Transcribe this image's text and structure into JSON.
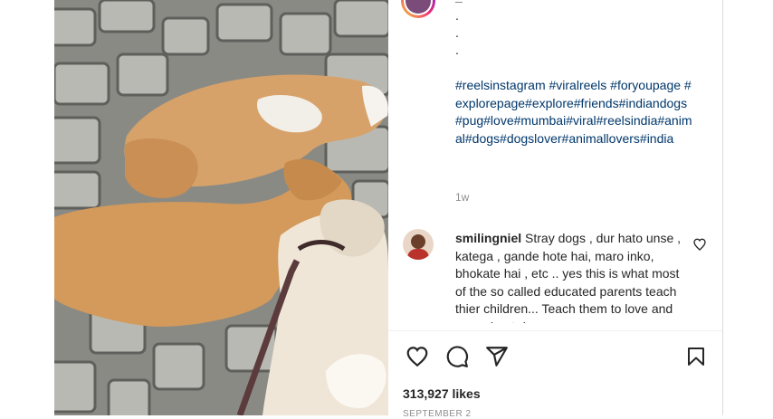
{
  "post": {
    "caption": {
      "username": "_",
      "dot_lines": ".\n.\n.",
      "hashtags": "#reelsinstagram #viralreels #foryoupage #explorepage#explore#friends#indiandogs#pug#love#mumbai#viral#reelsindia#animal#dogs#dogslover#animallovers#india",
      "time": "1w"
    },
    "comment": {
      "username": "smilingniel",
      "text": "Stray dogs , dur hato unse , katega , gande hote hai, maro inko, bhokate hai , etc .. yes this is what most of the so called educated parents teach thier children... Teach them to love and care about dogs"
    },
    "actions": {
      "like_icon": "heart-outline-icon",
      "comment_icon": "speech-bubble-icon",
      "share_icon": "paper-plane-icon",
      "save_icon": "bookmark-icon"
    },
    "likes": "313,927 likes",
    "bottom_text": "SEPTEMBER 2"
  },
  "colors": {
    "link": "#00376b",
    "text": "#262626",
    "muted": "#8e8e8e"
  }
}
